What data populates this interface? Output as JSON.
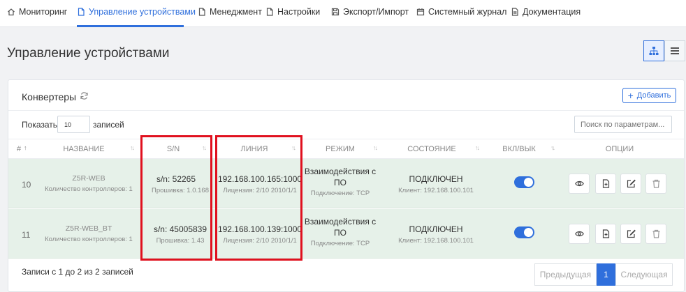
{
  "nav": {
    "items": [
      {
        "label": "Мониторинг",
        "icon": "home-icon"
      },
      {
        "label": "Управление устройствами",
        "icon": "document-icon"
      },
      {
        "label": "Менеджмент",
        "icon": "document-icon"
      },
      {
        "label": "Настройки",
        "icon": "document-icon"
      },
      {
        "label": "Экспорт/Импорт",
        "icon": "save-icon"
      },
      {
        "label": "Системный журнал",
        "icon": "calendar-icon"
      },
      {
        "label": "Документация",
        "icon": "file-icon"
      }
    ]
  },
  "page": {
    "title": "Управление устройствами"
  },
  "card": {
    "title": "Конвертеры",
    "add_label": "Добавить",
    "show_label": "Показать",
    "page_size": "10",
    "show_suffix": "записей",
    "search_placeholder": "Поиск по параметрам..."
  },
  "table": {
    "headers": {
      "num": "#",
      "name": "НАЗВАНИЕ",
      "sn": "S/N",
      "line": "ЛИНИЯ",
      "mode": "РЕЖИМ",
      "state": "СОСТОЯНИЕ",
      "onoff": "ВКЛ/ВЫК",
      "options": "ОПЦИИ"
    },
    "rows": [
      {
        "num": "10",
        "name": "Z5R-WEB",
        "controllers": "Количество контроллеров: 1",
        "sn": "s/n: 52265",
        "firmware": "Прошивка: 1.0.168",
        "ip": "192.168.100.165:1000",
        "license": "Лицензия: 2/10 2010/1/1",
        "mode_line1": "Взаимодействия с",
        "mode_line2": "ПО",
        "connection": "Подключение: TCP",
        "state": "ПОДКЛЮЧЕН",
        "client": "Клиент: 192.168.100.101",
        "enabled": true
      },
      {
        "num": "11",
        "name": "Z5R-WEB_BT",
        "controllers": "Количество контроллеров: 1",
        "sn": "s/n: 45005839",
        "firmware": "Прошивка: 1.43",
        "ip": "192.168.100.139:1000",
        "license": "Лицензия: 2/10 2010/1/1",
        "mode_line1": "Взаимодействия с",
        "mode_line2": "ПО",
        "connection": "Подключение: TCP",
        "state": "ПОДКЛЮЧЕН",
        "client": "Клиент: 192.168.100.101",
        "enabled": true
      }
    ]
  },
  "footer": {
    "info": "Записи с 1 до 2 из 2 записей",
    "prev": "Предыдущая",
    "page": "1",
    "next": "Следующая"
  },
  "colors": {
    "accent": "#2f6fdc",
    "row_bg": "#e6f1e9",
    "highlight": "#e0101e"
  }
}
